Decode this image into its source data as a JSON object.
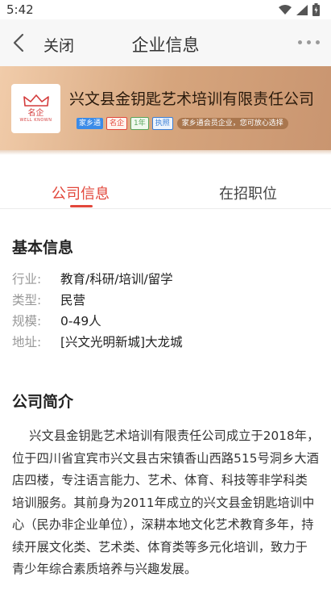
{
  "status_bar": {
    "time": "5:42"
  },
  "nav": {
    "close_label": "关闭",
    "title": "企业信息"
  },
  "company": {
    "name": "兴文县金钥匙艺术培训有限责任公司",
    "logo_text": "名企",
    "logo_sub": "WELL KNOWN",
    "tags": [
      "家乡通",
      "名企",
      "1年",
      "执照"
    ],
    "member_note": "家乡通会员企业，您可放心选择"
  },
  "tabs": [
    {
      "label": "公司信息",
      "active": true
    },
    {
      "label": "在招职位",
      "active": false
    }
  ],
  "basic_info": {
    "title": "基本信息",
    "rows": [
      {
        "label": "行业:",
        "value": "教育/科研/培训/留学"
      },
      {
        "label": "类型:",
        "value": "民营"
      },
      {
        "label": "规模:",
        "value": "0-49人"
      },
      {
        "label": "地址:",
        "value": "[兴文光明新城]大龙城"
      }
    ]
  },
  "intro": {
    "title": "公司简介",
    "text": "兴文县金钥匙艺术培训有限责任公司成立于2018年，位于四川省宜宾市兴文县古宋镇香山西路515号洞乡大酒店四楼，专注语言能力、艺术、体育、科技等非学科类培训服务。其前身为2011年成立的兴文县金钥匙培训中心（民办非企业单位），深耕本地文化艺术教育多年，持续开展文化类、艺术类、体育类等多元化培训，致力于青少年综合素质培养与兴趣发展。"
  },
  "colors": {
    "accent": "#e2473b",
    "banner": "#d6a57d"
  }
}
